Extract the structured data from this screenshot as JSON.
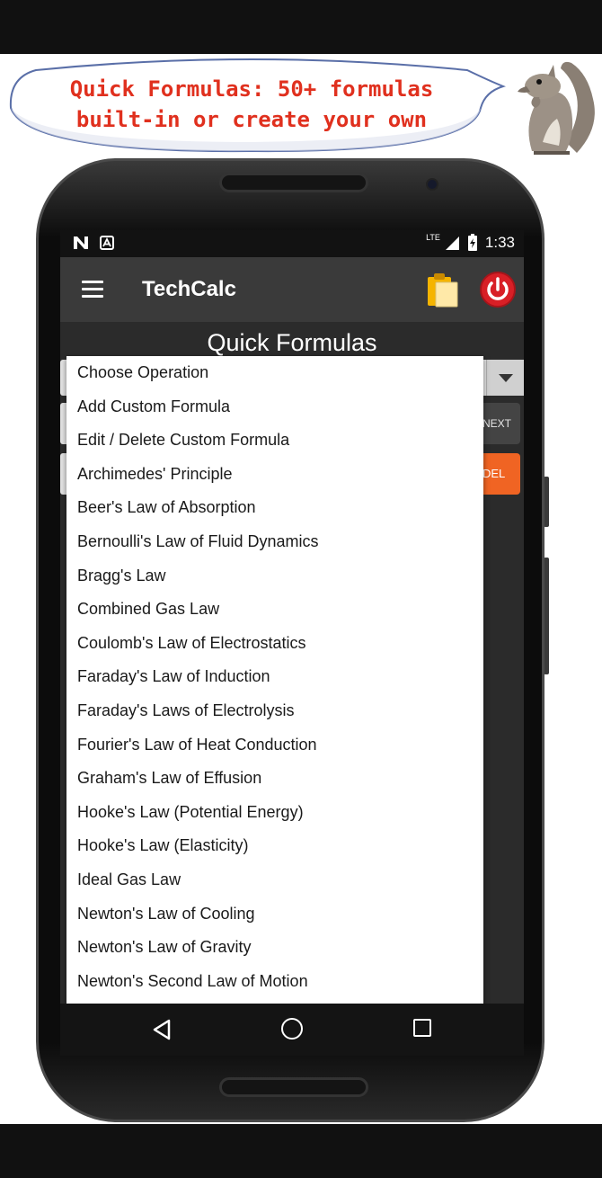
{
  "banner": {
    "line1": "Quick Formulas: 50+ formulas",
    "line2": "built-in or create your own"
  },
  "statusbar": {
    "time": "1:33",
    "network": "LTE",
    "left_icons": [
      "n-icon",
      "a-icon"
    ]
  },
  "appbar": {
    "title": "TechCalc",
    "icons": [
      "menu-icon",
      "clipboard-icon",
      "power-icon"
    ]
  },
  "screen": {
    "title": "Quick Formulas",
    "next_label": "NEXT",
    "del_label": "DEL"
  },
  "dropdown": {
    "items": [
      "Choose Operation",
      "Add Custom Formula",
      "Edit / Delete Custom Formula",
      "Archimedes' Principle",
      "Beer's Law of Absorption",
      "Bernoulli's Law of Fluid Dynamics",
      "Bragg's Law",
      "Combined Gas Law",
      "Coulomb's Law of Electrostatics",
      "Faraday's Law of Induction",
      "Faraday's Laws of Electrolysis",
      "Fourier's Law of Heat Conduction",
      "Graham's Law of Effusion",
      "Hooke's Law (Potential Energy)",
      "Hooke's Law (Elasticity)",
      "Ideal Gas Law",
      "Newton's Law of Cooling",
      "Newton's Law of Gravity",
      "Newton's Second Law of Motion"
    ]
  },
  "navbar": {
    "icons": [
      "back-icon",
      "home-icon",
      "recents-icon"
    ]
  },
  "colors": {
    "banner_text": "#e0301e",
    "appbar": "#3a3a3a",
    "del_button": "#f06423",
    "power_button": "#d81f26"
  }
}
